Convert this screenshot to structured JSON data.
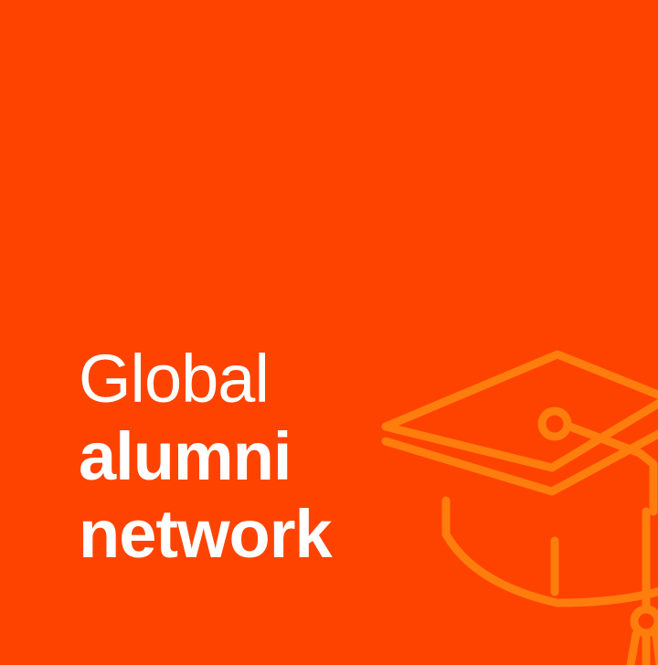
{
  "headline": {
    "line1": "Global",
    "line2": "alumni",
    "line3": "network"
  },
  "icon": {
    "name": "graduation-cap-icon",
    "color": "#ff7d0d"
  },
  "colors": {
    "background": "#fe4300",
    "text": "#ffffff",
    "accent": "#ff7d0d"
  }
}
